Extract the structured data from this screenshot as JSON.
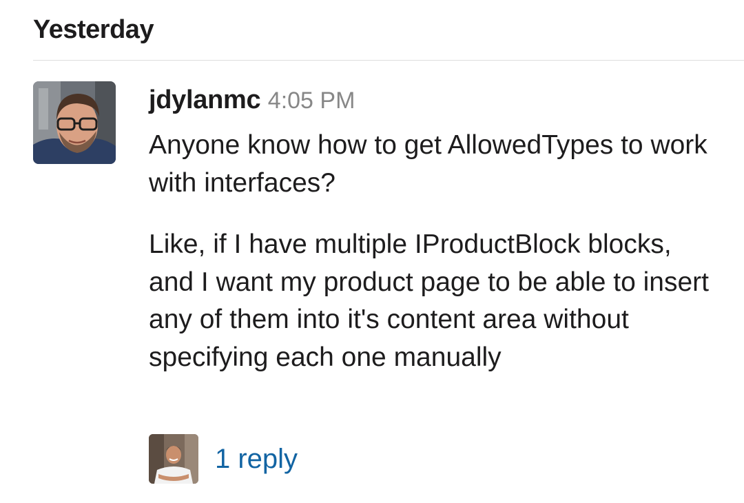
{
  "day_divider": {
    "label": "Yesterday"
  },
  "message": {
    "author": "jdylanmc",
    "timestamp": "4:05 PM",
    "avatar_icon": "user-avatar-photo",
    "paragraphs": [
      "Anyone know how to get AllowedTypes to work with interfaces?",
      "Like, if I have multiple IProductBlock blocks, and I want my product page to be able to insert any of them into it's content area without specifying each one manually"
    ]
  },
  "thread": {
    "reply_label": "1 reply",
    "replier_avatar_icon": "replier-avatar-photo"
  },
  "colors": {
    "link": "#1264a3",
    "timestamp": "#878787",
    "text": "#1d1c1d",
    "divider": "#dddddd"
  }
}
